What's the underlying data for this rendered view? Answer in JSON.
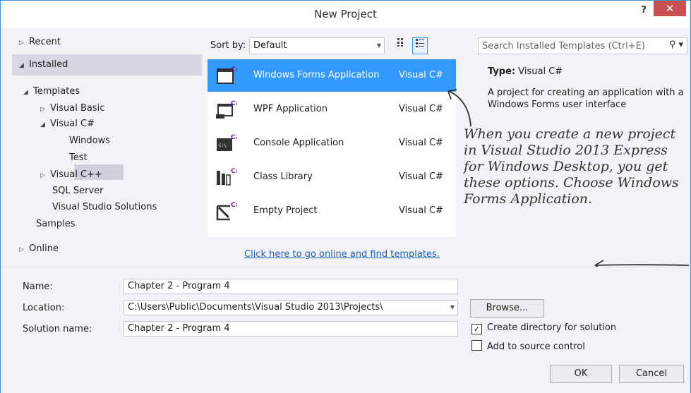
{
  "window": {
    "title": "New Project",
    "help_label": "?",
    "close_label": "✕"
  },
  "tree": {
    "recent": "Recent",
    "installed": "Installed",
    "templates": "Templates",
    "visual_basic": "Visual Basic",
    "visual_csharp": "Visual C#",
    "windows": "Windows",
    "test": "Test",
    "visual_cpp": "Visual C++",
    "sql_server": "SQL Server",
    "vs_solutions": "Visual Studio Solutions",
    "samples": "Samples",
    "online": "Online"
  },
  "toolbar": {
    "sort_label": "Sort by:",
    "sort_value": "Default",
    "search_placeholder": "Search Installed Templates (Ctrl+E)"
  },
  "templates": [
    {
      "name": "Windows Forms Application",
      "lang": "Visual C#",
      "icon": "winforms-icon"
    },
    {
      "name": "WPF Application",
      "lang": "Visual C#",
      "icon": "wpf-icon"
    },
    {
      "name": "Console Application",
      "lang": "Visual C#",
      "icon": "console-icon"
    },
    {
      "name": "Class Library",
      "lang": "Visual C#",
      "icon": "class-library-icon"
    },
    {
      "name": "Empty Project",
      "lang": "Visual C#",
      "icon": "empty-project-icon"
    }
  ],
  "online_link": "Click here to go online and find templates.",
  "info": {
    "type_key": "Type:",
    "type_value": "Visual C#",
    "description": "A project for creating an application with a Windows Forms user interface"
  },
  "annotation": "When you create a new project in Visual Studio 2013 Express for Windows Desktop, you get these options. Choose Windows Forms Application.",
  "form": {
    "name_label": "Name:",
    "name_value": "Chapter 2 - Program 4",
    "location_label": "Location:",
    "location_value": "C:\\Users\\Public\\Documents\\Visual Studio 2013\\Projects\\",
    "solution_label": "Solution name:",
    "solution_value": "Chapter 2 - Program 4",
    "browse": "Browse...",
    "create_dir": "Create directory for solution",
    "create_dir_checked": true,
    "source_control": "Add to source control",
    "source_control_checked": false,
    "ok": "OK",
    "cancel": "Cancel"
  },
  "colors": {
    "accent": "#3399ff",
    "link": "#1a5fb4",
    "close": "#c75050"
  }
}
